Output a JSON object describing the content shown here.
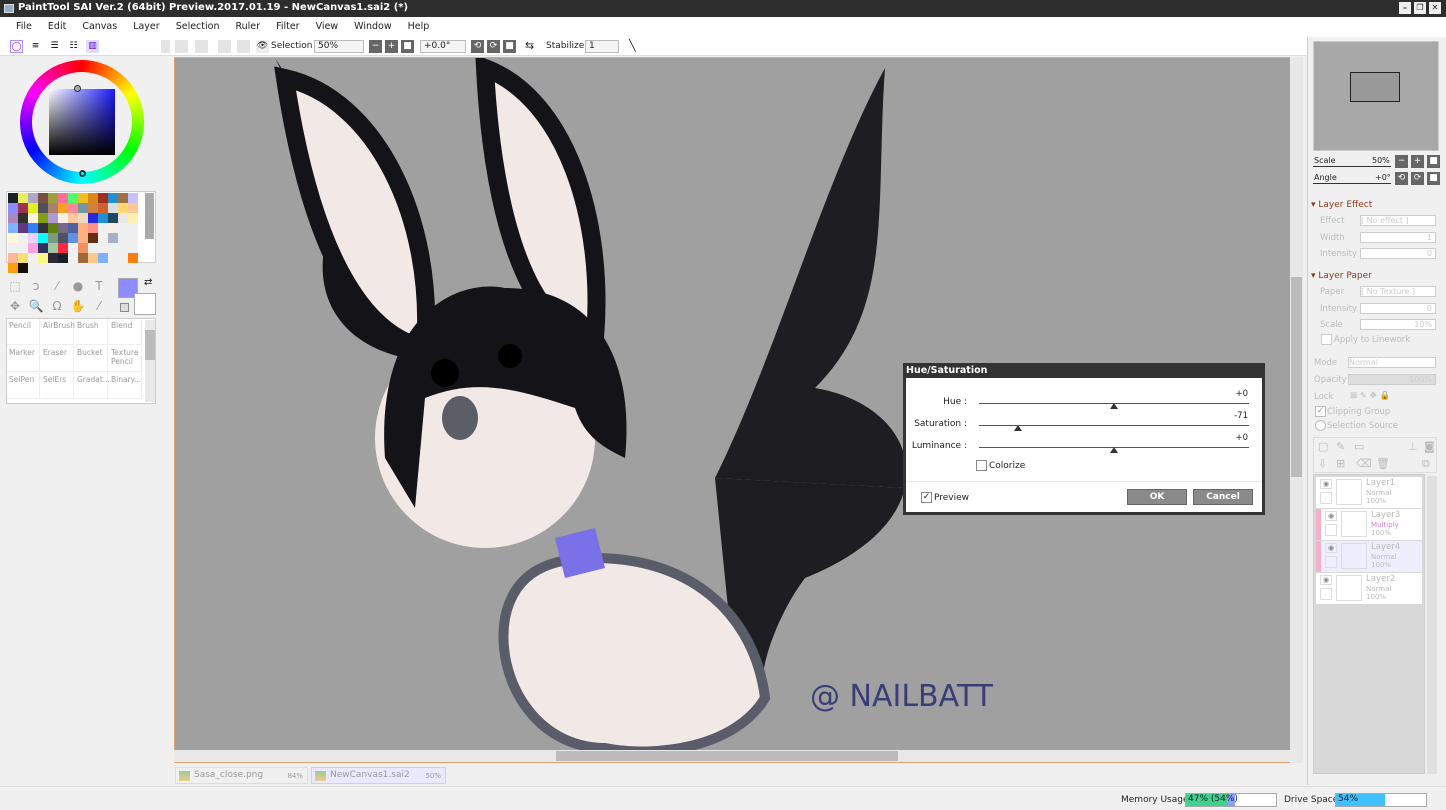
{
  "window": {
    "title": "PaintTool SAI Ver.2 (64bit) Preview.2017.01.19 - NewCanvas1.sai2 (*)"
  },
  "menu": [
    "File",
    "Edit",
    "Canvas",
    "Layer",
    "Selection",
    "Ruler",
    "Filter",
    "View",
    "Window",
    "Help"
  ],
  "toolbar": {
    "selection_label": "Selection",
    "zoom": "50%",
    "angle": "+0.0°",
    "stabilizer_label": "Stabilizer",
    "stabilizer": "1"
  },
  "colors": {
    "primary": "#8c8cff",
    "secondary": "#ffffff",
    "accent": "#e8a070"
  },
  "palette": [
    "#1a1f2a",
    "#e8f060",
    "#b0a8c0",
    "#7a5040",
    "#a0a040",
    "#ff7098",
    "#50ff70",
    "#f0c020",
    "#d88818",
    "#a03018",
    "#2090d0",
    "#a07040",
    "#c8c0ff",
    "#8c8cff",
    "#a03050",
    "#e0f020",
    "#505060",
    "#a88070",
    "#f8a020",
    "#ff8898",
    "#7098a0",
    "#d08040",
    "#d06030",
    "#d8e0e8",
    "#ffd870",
    "#ffc890",
    "#a888c0",
    "#303030",
    "#fff0e0",
    "#80a010",
    "#b098d0",
    "#f8f0e8",
    "#ffc8a0",
    "#f0d8c0",
    "#2828e0",
    "#2090d0",
    "#204860",
    "#e8e8e8",
    "#fff0b0",
    "#80b0ff",
    "#603880",
    "#3080ff",
    "#303040",
    "#608010",
    "#786888",
    "#5060a0",
    "#ffb080",
    "#ff9088",
    "#f0f0f0",
    "#f8f0e8",
    "#f0f0f0",
    "#f0f0f0",
    "#fff8d8",
    "#f0f0f0",
    "#f0d0ff",
    "#00ffff",
    "#809880",
    "#505060",
    "#6090e0",
    "#ffb080",
    "#603010",
    "#f0f0f0",
    "#a8b0c8",
    "#f0f0f0",
    "#f0f0f0",
    "#f0f0f0",
    "#f0f0f0",
    "#ffa0e0",
    "#303060",
    "#a0c8a0",
    "#ff2840",
    "#f0f0f0",
    "#f09060",
    "#f0f0f0",
    "#f0f0f0",
    "#f0f0f0",
    "#f0f0f0",
    "#f0f0f0",
    "#ffb898",
    "#f8e070",
    "#f0f0f0",
    "#f8f880",
    "#302838",
    "#182028",
    "#f0f0f0",
    "#a06838",
    "#ffc888",
    "#80b0ff",
    "#f0f0f0",
    "#f0f0f0",
    "#f88010",
    "#f8a010",
    "#181008",
    "#f0f0f0"
  ],
  "brushes": [
    {
      "name": "Pencil"
    },
    {
      "name": "AirBrush"
    },
    {
      "name": "Brush"
    },
    {
      "name": "Blend"
    },
    {
      "name": "Marker"
    },
    {
      "name": "Eraser"
    },
    {
      "name": "Bucket"
    },
    {
      "name": "Texture Pencil"
    },
    {
      "name": "SelPen"
    },
    {
      "name": "SelErs"
    },
    {
      "name": "Gradat..."
    },
    {
      "name": "Binary..."
    }
  ],
  "artwork": {
    "signature": "@ NAILBATT"
  },
  "tabs": [
    {
      "name": "Sasa_close.png",
      "zoom": "84%"
    },
    {
      "name": "NewCanvas1.sai2",
      "zoom": "50%"
    }
  ],
  "navigator": {
    "scale_label": "Scale",
    "scale": "50%",
    "angle_label": "Angle",
    "angle": "+0°"
  },
  "layer_effect": {
    "title": "Layer Effect",
    "effect_label": "Effect",
    "effect": "[ No effect ]",
    "width_label": "Width",
    "width": "1",
    "intensity_label": "Intensity",
    "intensity": "0"
  },
  "layer_paper": {
    "title": "Layer Paper",
    "paper_label": "Paper",
    "paper": "[ No Texture ]",
    "intensity_label": "Intensity",
    "intensity": "0",
    "scale_label": "Scale",
    "scale": "10%",
    "apply_label": "Apply to Linework"
  },
  "layer_props": {
    "mode_label": "Mode",
    "mode": "Normal",
    "opacity_label": "Opacity",
    "opacity": "100%",
    "lock_label": "Lock",
    "clipping_label": "Clipping Group",
    "selsource_label": "Selection Source"
  },
  "layers": [
    {
      "name": "Layer1",
      "mode": "Normal",
      "opacity": "100%"
    },
    {
      "name": "Layer3",
      "mode": "Multiply",
      "opacity": "100%"
    },
    {
      "name": "Layer4",
      "mode": "Normal",
      "opacity": "100%"
    },
    {
      "name": "Layer2",
      "mode": "Normal",
      "opacity": "100%"
    }
  ],
  "dialog": {
    "title": "Hue/Saturation",
    "hue_label": "Hue :",
    "hue": "+0",
    "hue_value": 0,
    "sat_label": "Saturation :",
    "sat": "-71",
    "sat_value": -71,
    "lum_label": "Luminance :",
    "lum": "+0",
    "lum_value": 0,
    "colorize_label": "Colorize",
    "preview_label": "Preview",
    "ok": "OK",
    "cancel": "Cancel"
  },
  "status": {
    "memory_label": "Memory Usage",
    "memory": "47% (54%)",
    "memory_pct": 47,
    "memory_peak_pct": 54,
    "drive_label": "Drive Space",
    "drive": "54%",
    "drive_pct": 54
  }
}
